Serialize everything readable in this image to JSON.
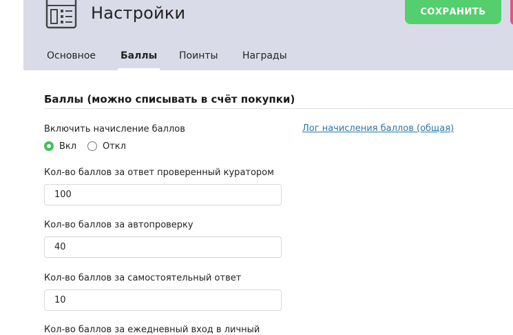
{
  "header": {
    "title": "Настройки",
    "save_label": "СОХРАНИТЬ",
    "app_icon": "settings-list-icon",
    "colors": {
      "header_bg": "#dadbe8",
      "save_bg": "#54cf6e",
      "accent_pink": "#e0577f"
    }
  },
  "tabs": [
    {
      "label": "Основное",
      "active": false
    },
    {
      "label": "Баллы",
      "active": true
    },
    {
      "label": "Поинты",
      "active": false
    },
    {
      "label": "Награды",
      "active": false
    }
  ],
  "section": {
    "title": "Баллы (можно списывать в счёт покупки)",
    "enable_label": "Включить начисление баллов",
    "log_link": "Лог начисления баллов (общая)",
    "radio": [
      {
        "label": "Вкл",
        "checked": true
      },
      {
        "label": "Откл",
        "checked": false
      }
    ],
    "fields": [
      {
        "label": "Кол-во баллов за ответ проверенный куратором",
        "value": "100"
      },
      {
        "label": "Кол-во баллов за автопроверку",
        "value": "40"
      },
      {
        "label": "Кол-во баллов за самостоятельный ответ",
        "value": "10"
      },
      {
        "label": "Кол-во баллов за ежедневный вход в личный"
      }
    ]
  }
}
